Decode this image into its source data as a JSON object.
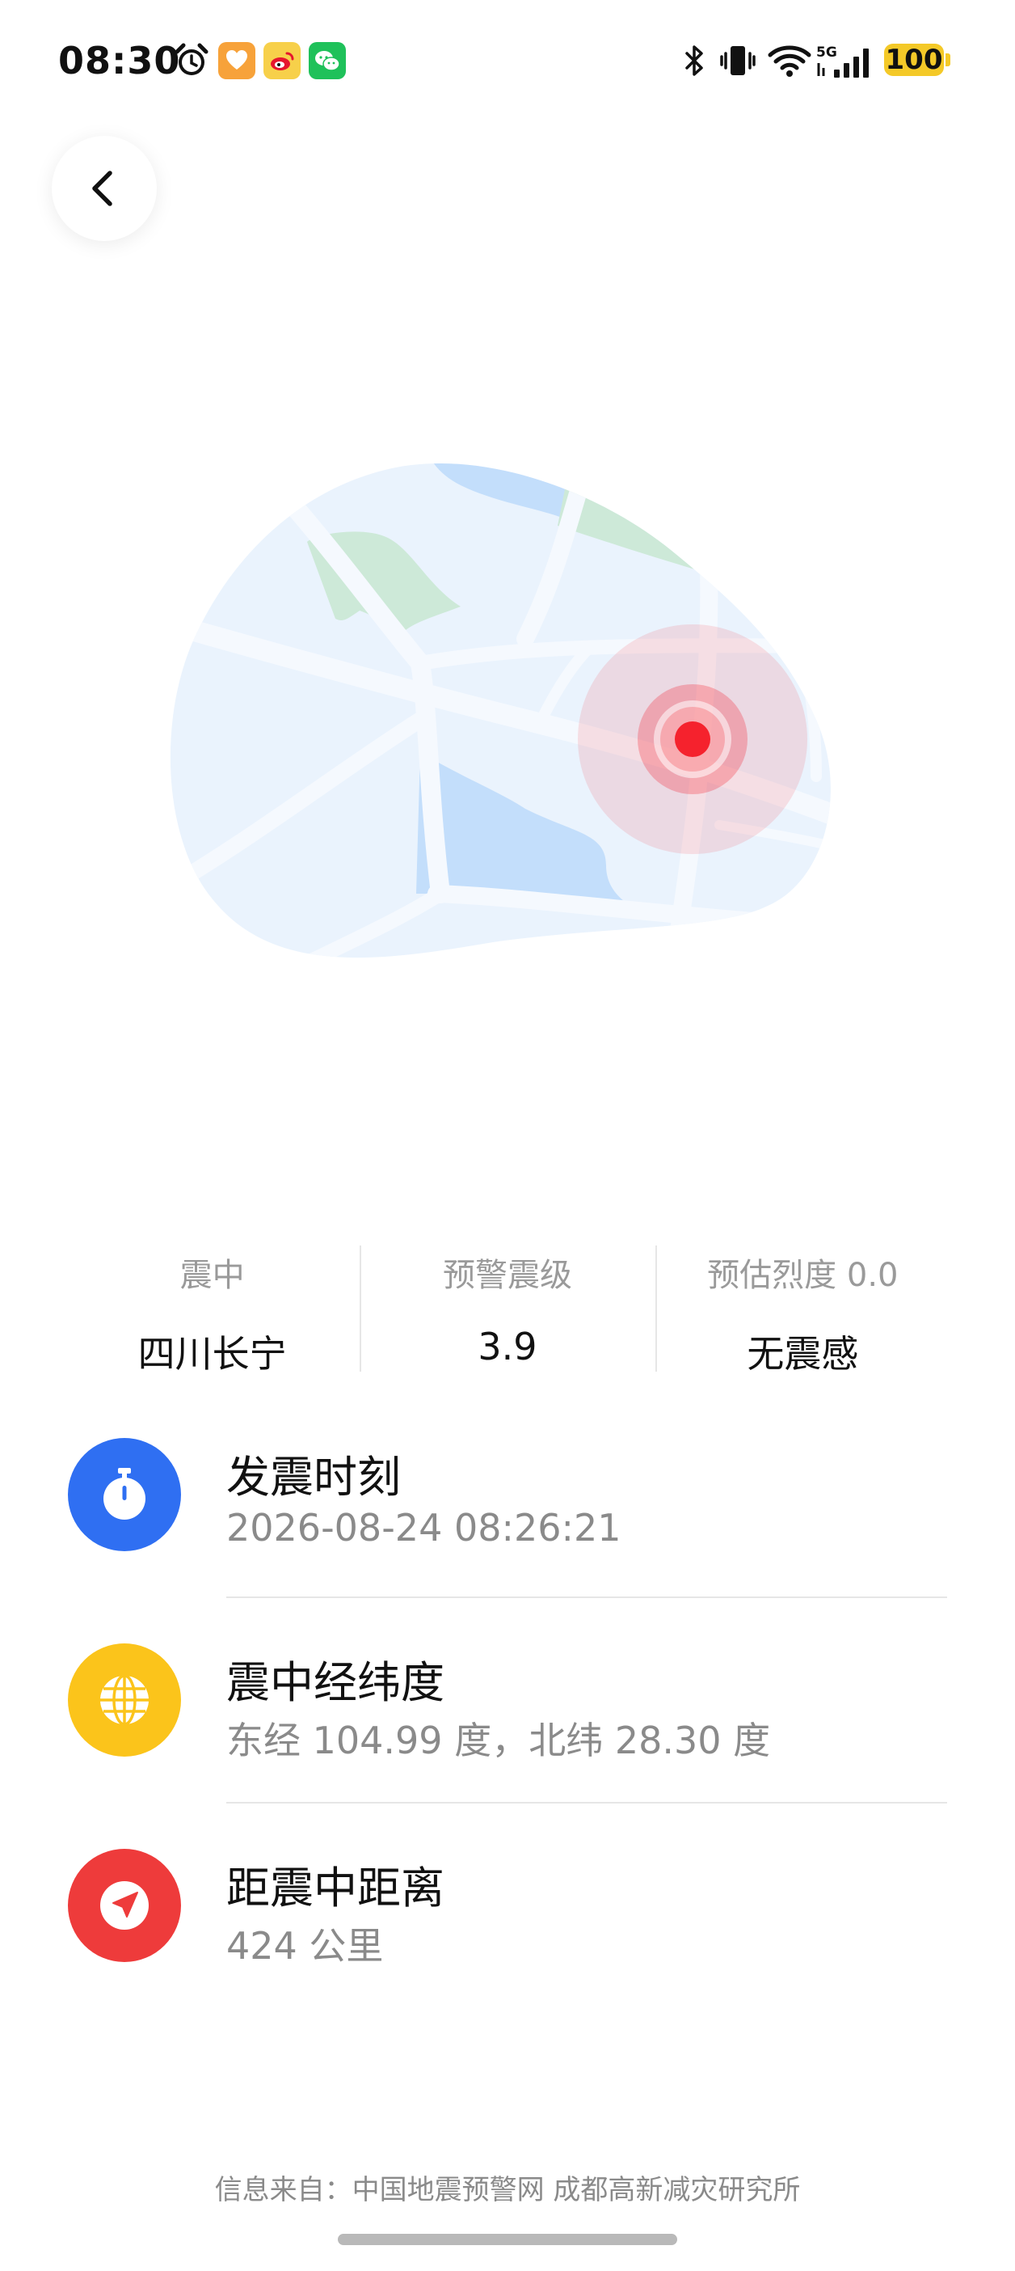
{
  "status_bar": {
    "time": "08:30",
    "battery": "100",
    "network": "5G",
    "icons": [
      "alarm-icon",
      "health-app-icon",
      "weibo-icon",
      "wechat-icon",
      "bluetooth-icon",
      "vibrate-icon",
      "wifi-icon",
      "signal-icon",
      "battery-icon"
    ]
  },
  "header": {
    "back_icon": "chevron-left-icon"
  },
  "summary": {
    "epicenter_label": "震中",
    "epicenter_value": "四川长宁",
    "magnitude_label": "预警震级",
    "magnitude_value": "3.9",
    "intensity_label": "预估烈度 0.0",
    "intensity_value": "无震感"
  },
  "details": [
    {
      "title": "发震时刻",
      "value": "2026-08-24 08:26:21",
      "icon": "stopwatch-icon",
      "color": "#2f6ff2"
    },
    {
      "title": "震中经纬度",
      "value": "东经 104.99 度，北纬 28.30 度",
      "icon": "globe-icon",
      "color": "#fbc41b"
    },
    {
      "title": "距震中距离",
      "value": "424 公里",
      "icon": "navigation-arrow-icon",
      "color": "#ee3b3b"
    }
  ],
  "footer": {
    "source": "信息来自：中国地震预警网 成都高新减灾研究所"
  },
  "colors": {
    "map_land": "#eaf3fd",
    "map_water": "#c3defb",
    "map_park": "#cde9d8",
    "epicenter": "#f5222d"
  }
}
